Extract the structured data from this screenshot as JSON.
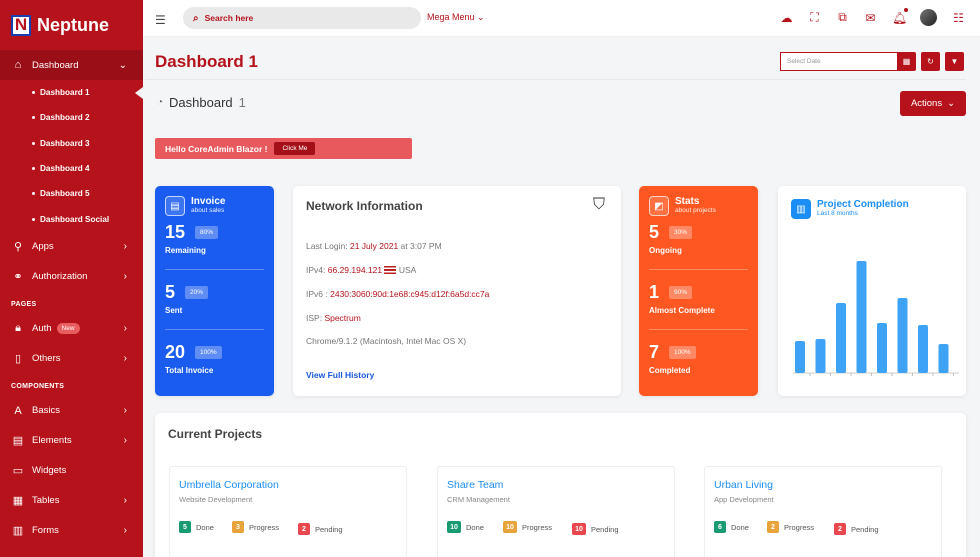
{
  "brand": {
    "logo_letter": "N",
    "name": "Neptune"
  },
  "sidebar": {
    "dashboard": "Dashboard",
    "sub_items": [
      "Dashboard 1",
      "Dashboard 2",
      "Dashboard 3",
      "Dashboard 4",
      "Dashboard 5",
      "Dashboard Social"
    ],
    "apps": "Apps",
    "authorization": "Authorization",
    "pages_label": "PAGES",
    "auth": "Auth",
    "auth_badge": "New",
    "others": "Others",
    "components_label": "COMPONENTS",
    "basics": "Basics",
    "elements": "Elements",
    "widgets": "Widgets",
    "tables": "Tables",
    "forms": "Forms"
  },
  "topbar": {
    "search_placeholder": "Search here",
    "mega_menu": "Mega Menu"
  },
  "header": {
    "title": "Dashboard 1",
    "date_placeholder": "Select Date"
  },
  "subheader": {
    "main": "Dashboard",
    "num": "1",
    "actions": "Actions"
  },
  "hello": {
    "text": "Hello CoreAdmin Blazor !",
    "button": "Click Me"
  },
  "invoice": {
    "title": "Invoice",
    "subtitle": "about sales",
    "rows": [
      {
        "num": "15",
        "pct": "80%",
        "label": "Remaining"
      },
      {
        "num": "5",
        "pct": "20%",
        "label": "Sent"
      },
      {
        "num": "20",
        "pct": "100%",
        "label": "Total Invoice"
      }
    ]
  },
  "network": {
    "title": "Network Information",
    "last_login_label": "Last Login:",
    "last_login_date": "21 July 2021",
    "last_login_time": "at 3:07 PM",
    "ipv4_label": "IPv4:",
    "ipv4": "66.29.194.121",
    "ipv4_country": "USA",
    "ipv6_label": "IPv6 :",
    "ipv6": "2430:3060:90d:1e68:c945:d12f:6a5d:cc7a",
    "isp_label": "ISP:",
    "isp": "Spectrum",
    "browser": "Chrome/9.1.2 (Macintosh, Intel Mac OS X)",
    "link": "View Full History"
  },
  "stats": {
    "title": "Stats",
    "subtitle": "about projects",
    "rows": [
      {
        "num": "5",
        "pct": "30%",
        "label": "Ongoing"
      },
      {
        "num": "1",
        "pct": "90%",
        "label": "Almost Complete"
      },
      {
        "num": "7",
        "pct": "100%",
        "label": "Completed"
      }
    ]
  },
  "project_completion": {
    "title": "Project Completion",
    "subtitle": "Last 8 months"
  },
  "chart_data": {
    "type": "bar",
    "values": [
      32,
      34,
      70,
      112,
      50,
      75,
      48,
      29
    ],
    "ylim": [
      0,
      120
    ],
    "color": "#3ea3f5"
  },
  "current_projects": {
    "title": "Current Projects",
    "projects": [
      {
        "name": "Umbrella Corporation",
        "type": "Website Development",
        "done": "5",
        "progress": "3",
        "pending": "2",
        "done_label": "Done",
        "progress_label": "Progress",
        "pending_label": "Pending"
      },
      {
        "name": "Share Team",
        "type": "CRM Management",
        "done": "10",
        "progress": "10",
        "pending": "10",
        "done_label": "Done",
        "progress_label": "Progress",
        "pending_label": "Pending"
      },
      {
        "name": "Urban Living",
        "type": "App Development",
        "done": "6",
        "progress": "2",
        "pending": "2",
        "done_label": "Done",
        "progress_label": "Progress",
        "pending_label": "Pending"
      }
    ]
  },
  "colors": {
    "brand": "#b5121b",
    "invoice": "#1a5cf0",
    "stats": "#ff5722",
    "done": "#1a9a73",
    "progress": "#e8a33a",
    "pending": "#e8474e"
  }
}
